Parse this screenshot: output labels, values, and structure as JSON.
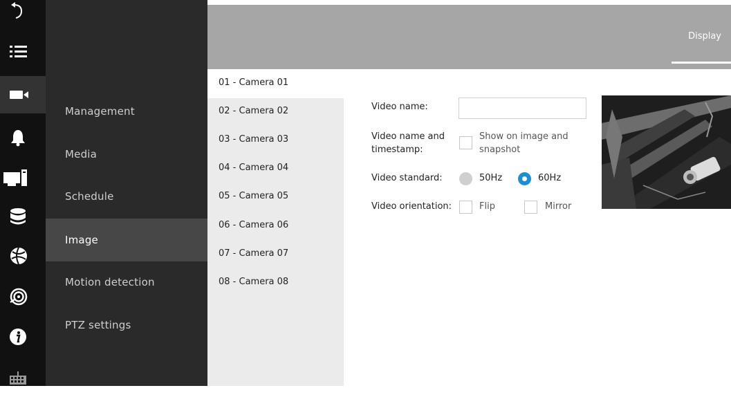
{
  "icon_bar": [
    {
      "name": "back-icon"
    },
    {
      "name": "list-icon"
    },
    {
      "name": "camera-icon",
      "active": true
    },
    {
      "name": "bell-icon"
    },
    {
      "name": "computer-icon"
    },
    {
      "name": "database-icon"
    },
    {
      "name": "globe-icon"
    },
    {
      "name": "fingerprint-icon"
    },
    {
      "name": "info-icon"
    },
    {
      "name": "keyboard-icon"
    }
  ],
  "menu": {
    "items": [
      "Management",
      "Media",
      "Schedule",
      "Image",
      "Motion detection",
      "PTZ settings"
    ],
    "selected": "Image"
  },
  "header": {
    "tab_display": "Display"
  },
  "cameras": [
    "01 - Camera 01",
    "02 - Camera 02",
    "03 - Camera 03",
    "04 - Camera 04",
    "05 - Camera 05",
    "06 - Camera 06",
    "07 - Camera 07",
    "08 - Camera 08"
  ],
  "selected_camera": "01 - Camera 01",
  "form": {
    "video_name_label": "Video name:",
    "video_name_value": "",
    "timestamp_label_1": "Video name and",
    "timestamp_label_2": "timestamp:",
    "show_on_image_1": "Show on image and",
    "show_on_image_2": "snapshot",
    "video_standard_label": "Video standard:",
    "opt_50hz": "50Hz",
    "opt_60hz": "60Hz",
    "video_standard_selected": "60Hz",
    "orientation_label": "Video orientation:",
    "flip_label": "Flip",
    "mirror_label": "Mirror",
    "show_on_image_checked": false,
    "flip_checked": false,
    "mirror_checked": false
  },
  "colors": {
    "accent": "#1a8fd6",
    "sidebar_dark": "#111111",
    "menu_bg": "#2a2a2a",
    "menu_selected": "#474747",
    "topbar": "#a6a6a6"
  }
}
